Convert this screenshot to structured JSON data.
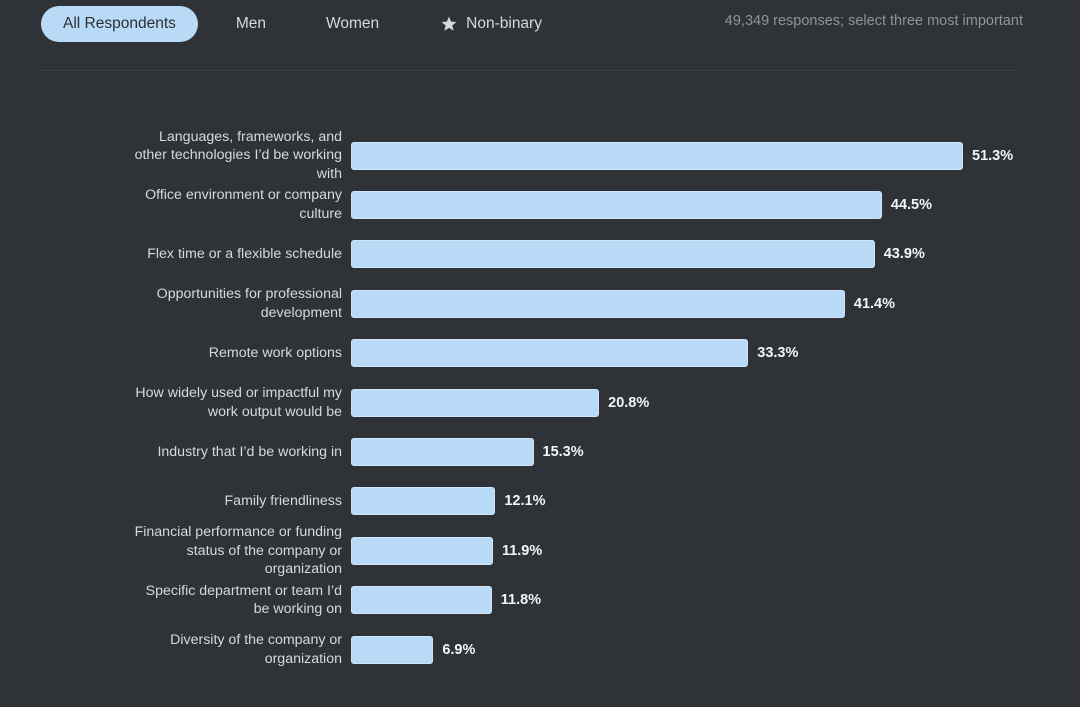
{
  "tabs": [
    {
      "id": "all",
      "label": "All Respondents",
      "active": true,
      "icon": null
    },
    {
      "id": "men",
      "label": "Men",
      "active": false,
      "icon": null
    },
    {
      "id": "women",
      "label": "Women",
      "active": false,
      "icon": null
    },
    {
      "id": "nonbinary",
      "label": "Non-binary",
      "active": false,
      "icon": "star-icon"
    }
  ],
  "header": {
    "responses_note": "49,349 responses; select three most important"
  },
  "colors": {
    "background": "#2f3338",
    "bar": "#b9daf6",
    "active_tab_bg": "#b9daf6",
    "active_tab_text": "#2c3034",
    "label_text": "#d6d9dc",
    "muted_text": "#8d949b",
    "value_text": "#f2f4f6",
    "divider": "#3a3f45"
  },
  "chart_data": {
    "type": "bar",
    "orientation": "horizontal",
    "title": "",
    "subtitle": "",
    "xlabel": "",
    "ylabel": "",
    "grid": false,
    "legend": null,
    "xlim": [
      0,
      51.3
    ],
    "value_suffix": "%",
    "categories": [
      "Languages, frameworks, and\nother technologies I’d be working\nwith",
      "Office environment or company\nculture",
      "Flex time or a flexible schedule",
      "Opportunities for professional\ndevelopment",
      "Remote work options",
      "How widely used or impactful my\nwork output would be",
      "Industry that I’d be working in",
      "Family friendliness",
      "Financial performance or funding\nstatus of the company or\norganization",
      "Specific department or team I’d\nbe working on",
      "Diversity of the company or\norganization"
    ],
    "values": [
      51.3,
      44.5,
      43.9,
      41.4,
      33.3,
      20.8,
      15.3,
      12.1,
      11.9,
      11.8,
      6.9
    ],
    "value_labels": [
      "51.3%",
      "44.5%",
      "43.9%",
      "41.4%",
      "33.3%",
      "20.8%",
      "15.3%",
      "12.1%",
      "11.9%",
      "11.8%",
      "6.9%"
    ]
  }
}
